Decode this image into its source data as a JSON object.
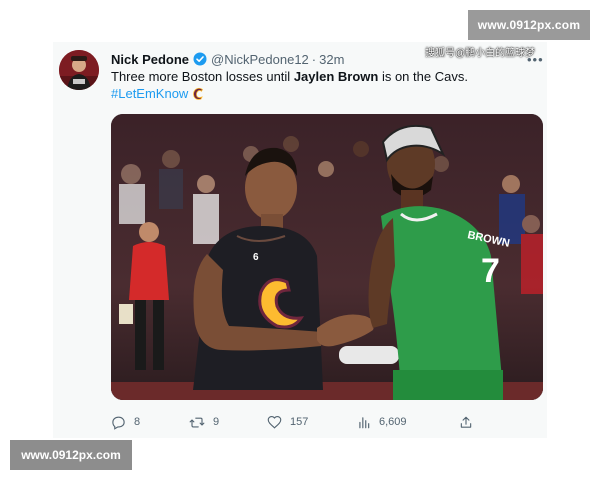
{
  "watermark": {
    "top": "www.0912px.com",
    "bottom": "www.0912px.com"
  },
  "image_overlay_text": "搜狐号@鹏小白的篮球梦",
  "tweet": {
    "display_name": "Nick Pedone",
    "handle": "@NickPedone12",
    "separator": "·",
    "timestamp": "32m",
    "verified": true,
    "text_before": "Three more Boston losses until ",
    "text_bold": "Jaylen Brown",
    "text_after": " is on the Cavs.",
    "hashtag": "#LetEmKnow",
    "hashtag_emoji": "cavaliers-c-logo",
    "media": {
      "left_jersey_number": "6",
      "right_jersey_number": "7",
      "right_jersey_name": "BROWN"
    }
  },
  "actions": {
    "reply_count": "8",
    "retweet_count": "9",
    "like_count": "157",
    "views_count": "6,609"
  },
  "icons": [
    "verified-badge-icon",
    "more-icon",
    "reply-icon",
    "retweet-icon",
    "like-icon",
    "views-icon",
    "share-icon"
  ],
  "colors": {
    "link": "#1d9bf0",
    "verified": "#1d9bf0",
    "secondary_text": "#536471",
    "card_bg": "#f7f9f9",
    "cavs_wine": "#6f263d",
    "celtics_green": "#2e9c4a"
  }
}
